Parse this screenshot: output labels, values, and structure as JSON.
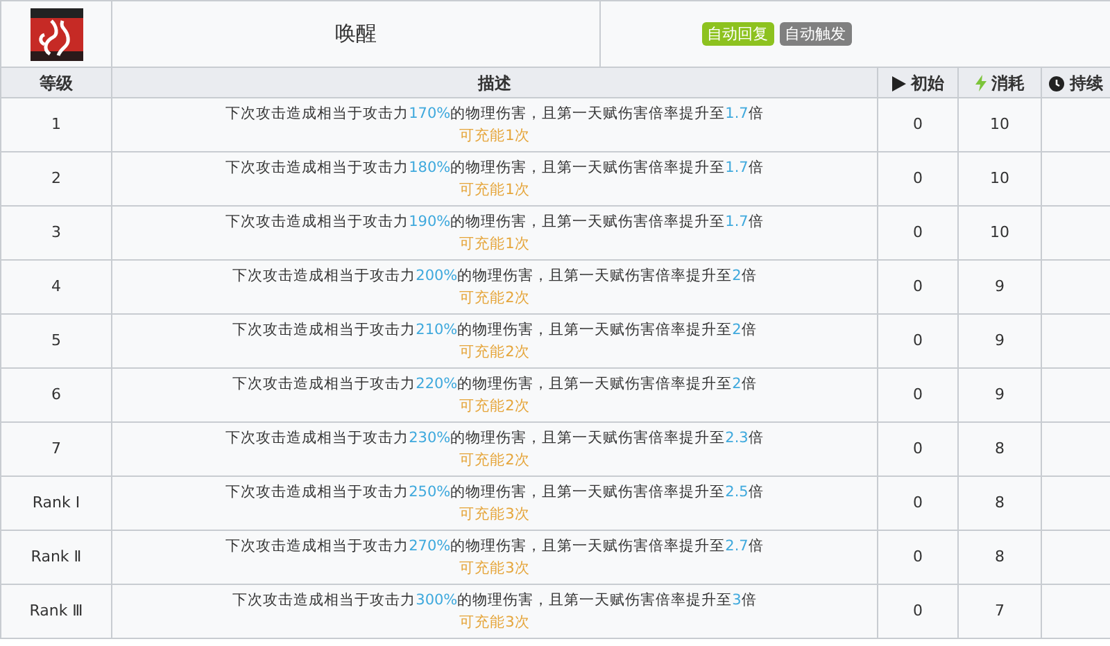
{
  "skill": {
    "name": "唤醒",
    "tags": [
      {
        "label": "自动回复",
        "color": "#8dc21f"
      },
      {
        "label": "自动触发",
        "color": "#808080"
      }
    ]
  },
  "columns": [
    {
      "label": "等级"
    },
    {
      "label": "描述"
    },
    {
      "label": "初始"
    },
    {
      "label": "消耗"
    },
    {
      "label": "持续"
    }
  ],
  "rows": [
    {
      "level": "1",
      "description": [
        {
          "text": "下次攻击造成相当于攻击力",
          "highlight": false
        },
        {
          "text": "170%",
          "highlight": true
        },
        {
          "text": "的物理伤害，且第一天赋伤害倍率提升至",
          "highlight": false
        },
        {
          "text": "1.7",
          "highlight": true
        },
        {
          "text": "倍",
          "highlight": false
        }
      ],
      "charges": "可充能1次",
      "initial": "0",
      "cost": "10"
    },
    {
      "level": "2",
      "description": [
        {
          "text": "下次攻击造成相当于攻击力",
          "highlight": false
        },
        {
          "text": "180%",
          "highlight": true
        },
        {
          "text": "的物理伤害，且第一天赋伤害倍率提升至",
          "highlight": false
        },
        {
          "text": "1.7",
          "highlight": true
        },
        {
          "text": "倍",
          "highlight": false
        }
      ],
      "charges": "可充能1次",
      "initial": "0",
      "cost": "10"
    },
    {
      "level": "3",
      "description": [
        {
          "text": "下次攻击造成相当于攻击力",
          "highlight": false
        },
        {
          "text": "190%",
          "highlight": true
        },
        {
          "text": "的物理伤害，且第一天赋伤害倍率提升至",
          "highlight": false
        },
        {
          "text": "1.7",
          "highlight": true
        },
        {
          "text": "倍",
          "highlight": false
        }
      ],
      "charges": "可充能1次",
      "initial": "0",
      "cost": "10"
    },
    {
      "level": "4",
      "description": [
        {
          "text": "下次攻击造成相当于攻击力",
          "highlight": false
        },
        {
          "text": "200%",
          "highlight": true
        },
        {
          "text": "的物理伤害，且第一天赋伤害倍率提升至",
          "highlight": false
        },
        {
          "text": "2",
          "highlight": true
        },
        {
          "text": "倍",
          "highlight": false
        }
      ],
      "charges": "可充能2次",
      "initial": "0",
      "cost": "9"
    },
    {
      "level": "5",
      "description": [
        {
          "text": "下次攻击造成相当于攻击力",
          "highlight": false
        },
        {
          "text": "210%",
          "highlight": true
        },
        {
          "text": "的物理伤害，且第一天赋伤害倍率提升至",
          "highlight": false
        },
        {
          "text": "2",
          "highlight": true
        },
        {
          "text": "倍",
          "highlight": false
        }
      ],
      "charges": "可充能2次",
      "initial": "0",
      "cost": "9"
    },
    {
      "level": "6",
      "description": [
        {
          "text": "下次攻击造成相当于攻击力",
          "highlight": false
        },
        {
          "text": "220%",
          "highlight": true
        },
        {
          "text": "的物理伤害，且第一天赋伤害倍率提升至",
          "highlight": false
        },
        {
          "text": "2",
          "highlight": true
        },
        {
          "text": "倍",
          "highlight": false
        }
      ],
      "charges": "可充能2次",
      "initial": "0",
      "cost": "9"
    },
    {
      "level": "7",
      "description": [
        {
          "text": "下次攻击造成相当于攻击力",
          "highlight": false
        },
        {
          "text": "230%",
          "highlight": true
        },
        {
          "text": "的物理伤害，且第一天赋伤害倍率提升至",
          "highlight": false
        },
        {
          "text": "2.3",
          "highlight": true
        },
        {
          "text": "倍",
          "highlight": false
        }
      ],
      "charges": "可充能2次",
      "initial": "0",
      "cost": "8"
    },
    {
      "level": "Rank Ⅰ",
      "description": [
        {
          "text": "下次攻击造成相当于攻击力",
          "highlight": false
        },
        {
          "text": "250%",
          "highlight": true
        },
        {
          "text": "的物理伤害，且第一天赋伤害倍率提升至",
          "highlight": false
        },
        {
          "text": "2.5",
          "highlight": true
        },
        {
          "text": "倍",
          "highlight": false
        }
      ],
      "charges": "可充能3次",
      "initial": "0",
      "cost": "8"
    },
    {
      "level": "Rank Ⅱ",
      "description": [
        {
          "text": "下次攻击造成相当于攻击力",
          "highlight": false
        },
        {
          "text": "270%",
          "highlight": true
        },
        {
          "text": "的物理伤害，且第一天赋伤害倍率提升至",
          "highlight": false
        },
        {
          "text": "2.7",
          "highlight": true
        },
        {
          "text": "倍",
          "highlight": false
        }
      ],
      "charges": "可充能3次",
      "initial": "0",
      "cost": "8"
    },
    {
      "level": "Rank Ⅲ",
      "description": [
        {
          "text": "下次攻击造成相当于攻击力",
          "highlight": false
        },
        {
          "text": "300%",
          "highlight": true
        },
        {
          "text": "的物理伤害，且第一天赋伤害倍率提升至",
          "highlight": false
        },
        {
          "text": "3",
          "highlight": true
        },
        {
          "text": "倍",
          "highlight": false
        }
      ],
      "charges": "可充能3次",
      "initial": "0",
      "cost": "7"
    }
  ]
}
